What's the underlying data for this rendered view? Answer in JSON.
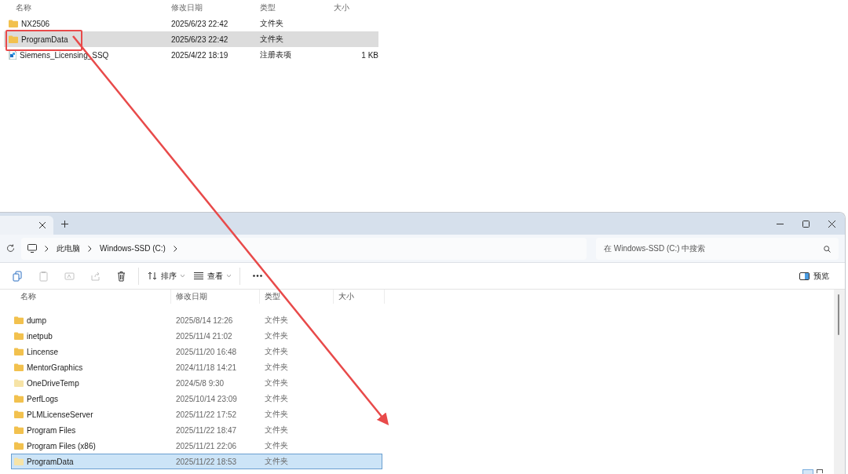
{
  "top_list": {
    "columns": [
      "名称",
      "修改日期",
      "类型",
      "大小"
    ],
    "rows": [
      {
        "kind": "folder",
        "name": "NX2506",
        "date": "2025/6/23 22:42",
        "type": "文件夹",
        "size": "",
        "selected": false
      },
      {
        "kind": "folder",
        "name": "ProgramData",
        "date": "2025/6/23 22:42",
        "type": "文件夹",
        "size": "",
        "selected": true
      },
      {
        "kind": "registry",
        "name": "Siemens_Licensing_SSQ",
        "date": "2025/4/22 18:19",
        "type": "注册表项",
        "size": "1 KB",
        "selected": false
      }
    ]
  },
  "explorer": {
    "breadcrumb": [
      "此电脑",
      "Windows-SSD (C:)"
    ],
    "search": {
      "placeholder": "在 Windows-SSD (C:) 中搜索"
    },
    "toolbar": {
      "icon_buttons": [
        {
          "disabled": false
        },
        {
          "disabled": true
        },
        {
          "disabled": true
        },
        {
          "disabled": true
        },
        {
          "disabled": false
        }
      ],
      "sort": "排序",
      "view": "查看",
      "preview": "预览"
    },
    "columns": [
      "名称",
      "修改日期",
      "类型",
      "大小"
    ],
    "rows": [
      {
        "name": "dump",
        "date": "2025/8/14 12:26",
        "type": "文件夹",
        "hidden": false,
        "selected": false
      },
      {
        "name": "inetpub",
        "date": "2025/11/4 21:02",
        "type": "文件夹",
        "hidden": false,
        "selected": false
      },
      {
        "name": "Lincense",
        "date": "2025/11/20 16:48",
        "type": "文件夹",
        "hidden": false,
        "selected": false
      },
      {
        "name": "MentorGraphics",
        "date": "2024/11/18 14:21",
        "type": "文件夹",
        "hidden": false,
        "selected": false
      },
      {
        "name": "OneDriveTemp",
        "date": "2024/5/8 9:30",
        "type": "文件夹",
        "hidden": true,
        "selected": false
      },
      {
        "name": "PerfLogs",
        "date": "2025/10/14 23:09",
        "type": "文件夹",
        "hidden": false,
        "selected": false
      },
      {
        "name": "PLMLicenseServer",
        "date": "2025/11/22 17:52",
        "type": "文件夹",
        "hidden": false,
        "selected": false
      },
      {
        "name": "Program Files",
        "date": "2025/11/22 18:47",
        "type": "文件夹",
        "hidden": false,
        "selected": false
      },
      {
        "name": "Program Files (x86)",
        "date": "2025/11/21 22:06",
        "type": "文件夹",
        "hidden": false,
        "selected": false
      },
      {
        "name": "ProgramData",
        "date": "2025/11/22 18:53",
        "type": "文件夹",
        "hidden": true,
        "selected": true
      }
    ]
  }
}
